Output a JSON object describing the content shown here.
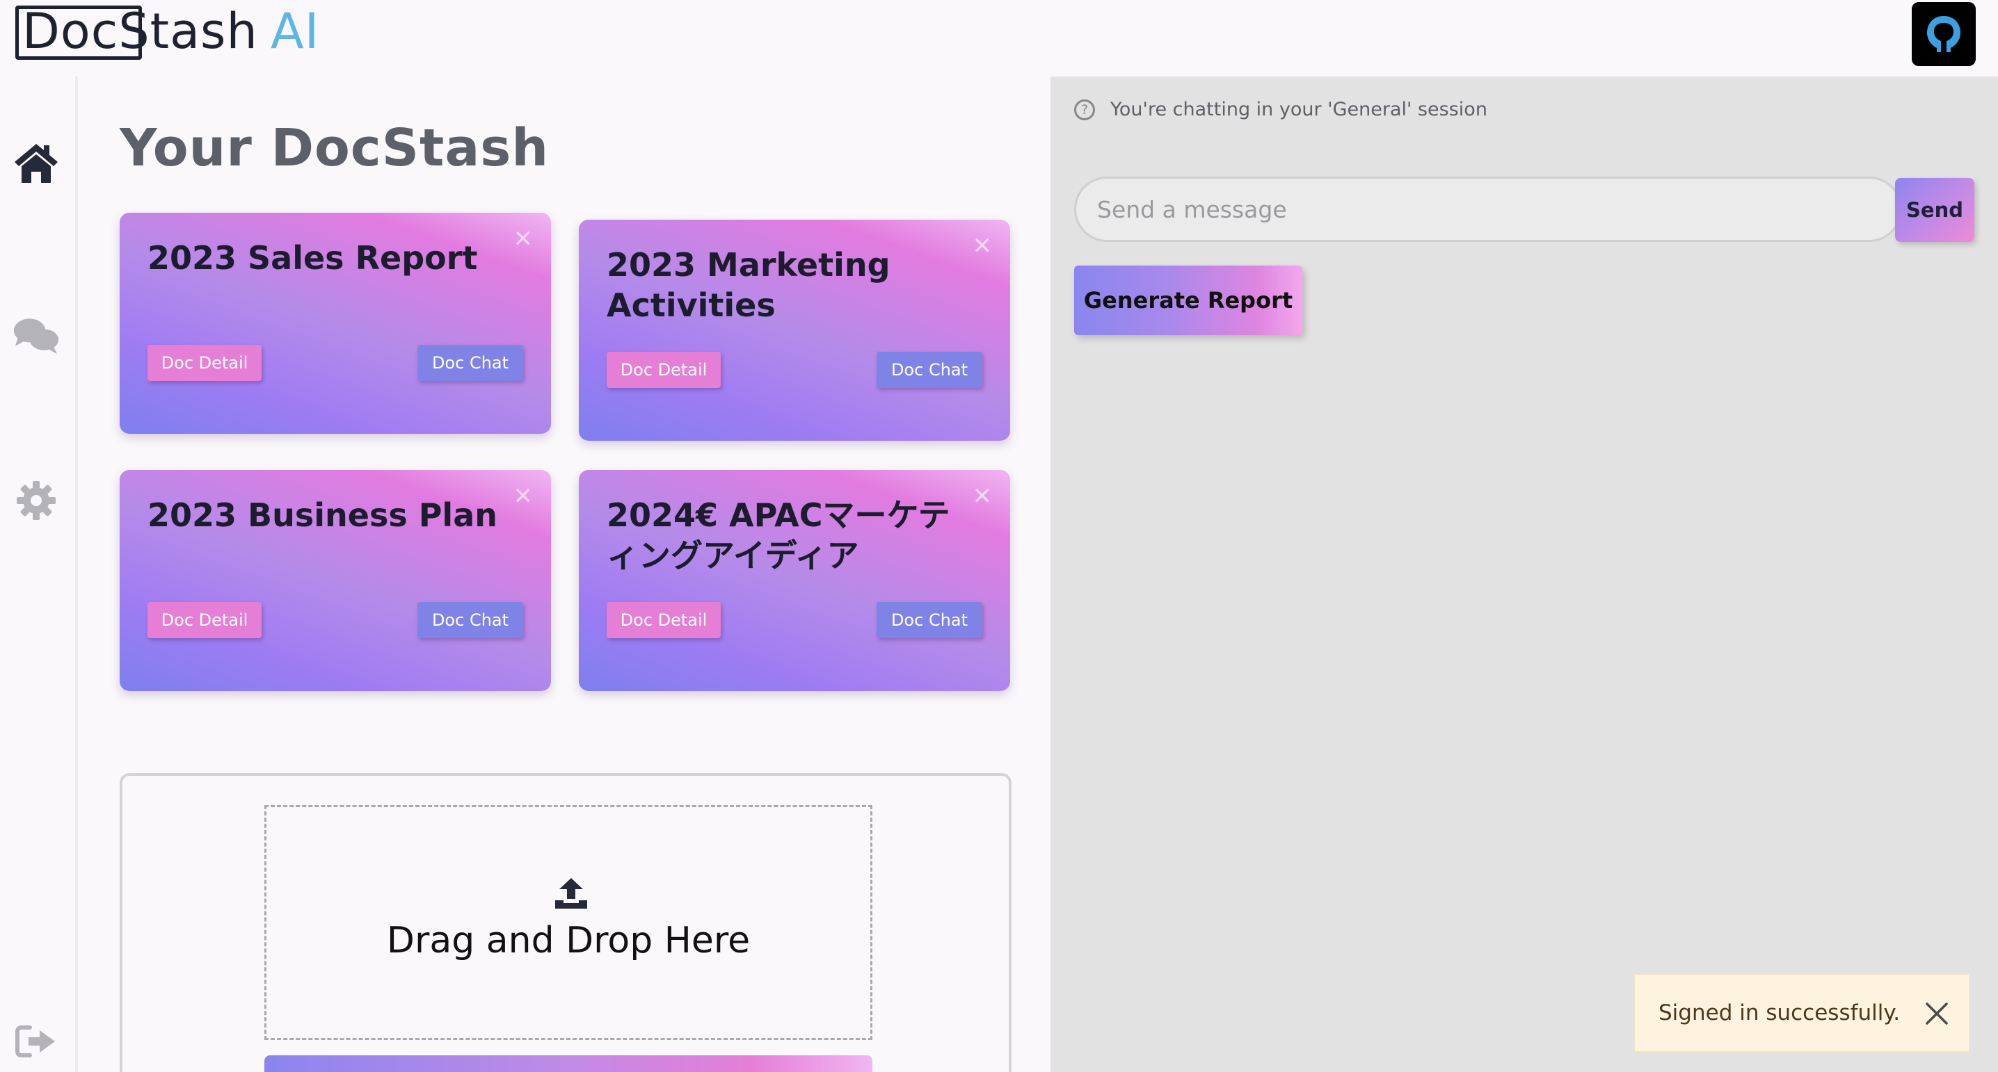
{
  "header": {
    "logo_main": "DocStash",
    "logo_accent": "AI"
  },
  "sidebar": {
    "items": [
      {
        "name": "home",
        "icon": "home-icon"
      },
      {
        "name": "chats",
        "icon": "chat-bubbles-icon"
      },
      {
        "name": "settings",
        "icon": "gear-icon"
      },
      {
        "name": "logout",
        "icon": "sign-out-icon"
      }
    ]
  },
  "main": {
    "title": "Your DocStash",
    "documents": [
      {
        "title": "2023 Sales Report",
        "detail_label": "Doc Detail",
        "chat_label": "Doc Chat",
        "close": "✕"
      },
      {
        "title": "2023 Marketing Activities",
        "detail_label": "Doc Detail",
        "chat_label": "Doc Chat",
        "close": "✕"
      },
      {
        "title": "2023 Business Plan",
        "detail_label": "Doc Detail",
        "chat_label": "Doc Chat",
        "close": "✕"
      },
      {
        "title": "2024€ APACマーケティングアイディア",
        "detail_label": "Doc Detail",
        "chat_label": "Doc Chat",
        "close": "✕"
      }
    ],
    "upload": {
      "drop_text": "Drag and Drop Here"
    }
  },
  "chat": {
    "session_text": "You're chatting in your 'General' session",
    "input_placeholder": "Send a message",
    "send_label": "Send",
    "generate_label": "Generate Report"
  },
  "toast": {
    "message": "Signed in successfully."
  },
  "colors": {
    "accent_blue": "#5fb6e6",
    "card_pink": "#e27be0",
    "card_violet": "#7e7ff0",
    "toast_bg": "#fdf3df"
  }
}
